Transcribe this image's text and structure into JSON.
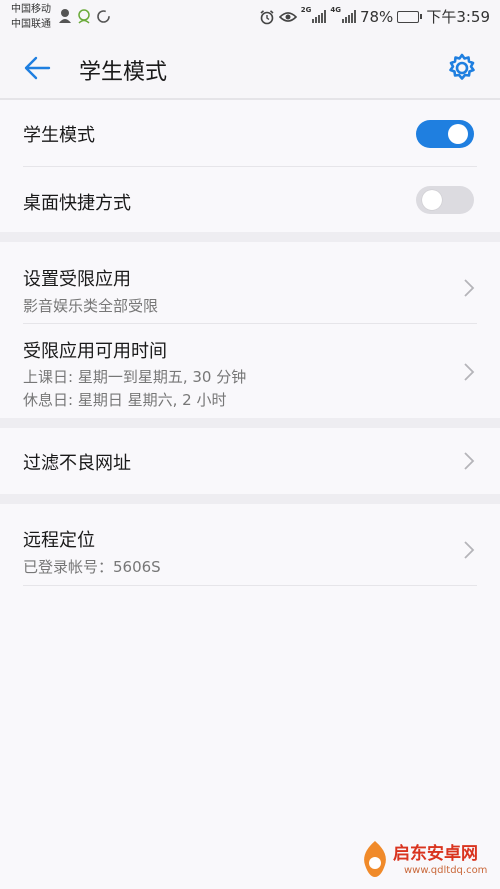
{
  "status_bar": {
    "carrier_1": "中国移动",
    "carrier_2": "中国联通",
    "net_1": "2G",
    "net_2": "4G",
    "battery_pct": "78%",
    "battery_level": 0.78,
    "time": "下午3:59"
  },
  "app_bar": {
    "title": "学生模式",
    "back_icon": "arrow-left-icon",
    "settings_icon": "gear-icon"
  },
  "colors": {
    "accent": "#1f7fe0",
    "toggle_off": "#dcdbe0",
    "background": "#f9f8fb",
    "section_gap": "#eeedf1"
  },
  "settings": {
    "student_mode": {
      "label": "学生模式",
      "enabled": true
    },
    "desktop_shortcut": {
      "label": "桌面快捷方式",
      "enabled": false
    },
    "restricted_apps": {
      "label": "设置受限应用",
      "sub": "影音娱乐类全部受限"
    },
    "usage_time": {
      "label": "受限应用可用时间",
      "school_day": "上课日: 星期一到星期五, 30 分钟",
      "rest_day": "休息日: 星期日 星期六, 2 小时"
    },
    "filter_urls": {
      "label": "过滤不良网址"
    },
    "remote_location": {
      "label": "远程定位",
      "sub": "已登录帐号：5606S"
    }
  },
  "watermark": {
    "brand": "启东安卓网",
    "url": "www.qdltdq.com"
  }
}
